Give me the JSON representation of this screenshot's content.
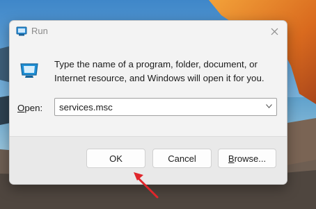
{
  "dialog": {
    "title": "Run",
    "description": "Type the name of a program, folder, document, or Internet resource, and Windows will open it for you.",
    "open_label_accel": "O",
    "open_label_rest": "pen:",
    "open_value": "services.msc"
  },
  "buttons": {
    "ok": "OK",
    "cancel": "Cancel",
    "browse_accel": "B",
    "browse_rest": "rowse..."
  },
  "icons": {
    "title": "run-icon",
    "close": "close-icon",
    "dropdown": "chevron-down-icon",
    "annotation": "red-arrow"
  },
  "colors": {
    "run_icon": "#1e8fd6",
    "annotation_arrow": "#e0262b",
    "dialog_bg": "#f3f3f3",
    "footer_bg": "#e9e9e9"
  }
}
